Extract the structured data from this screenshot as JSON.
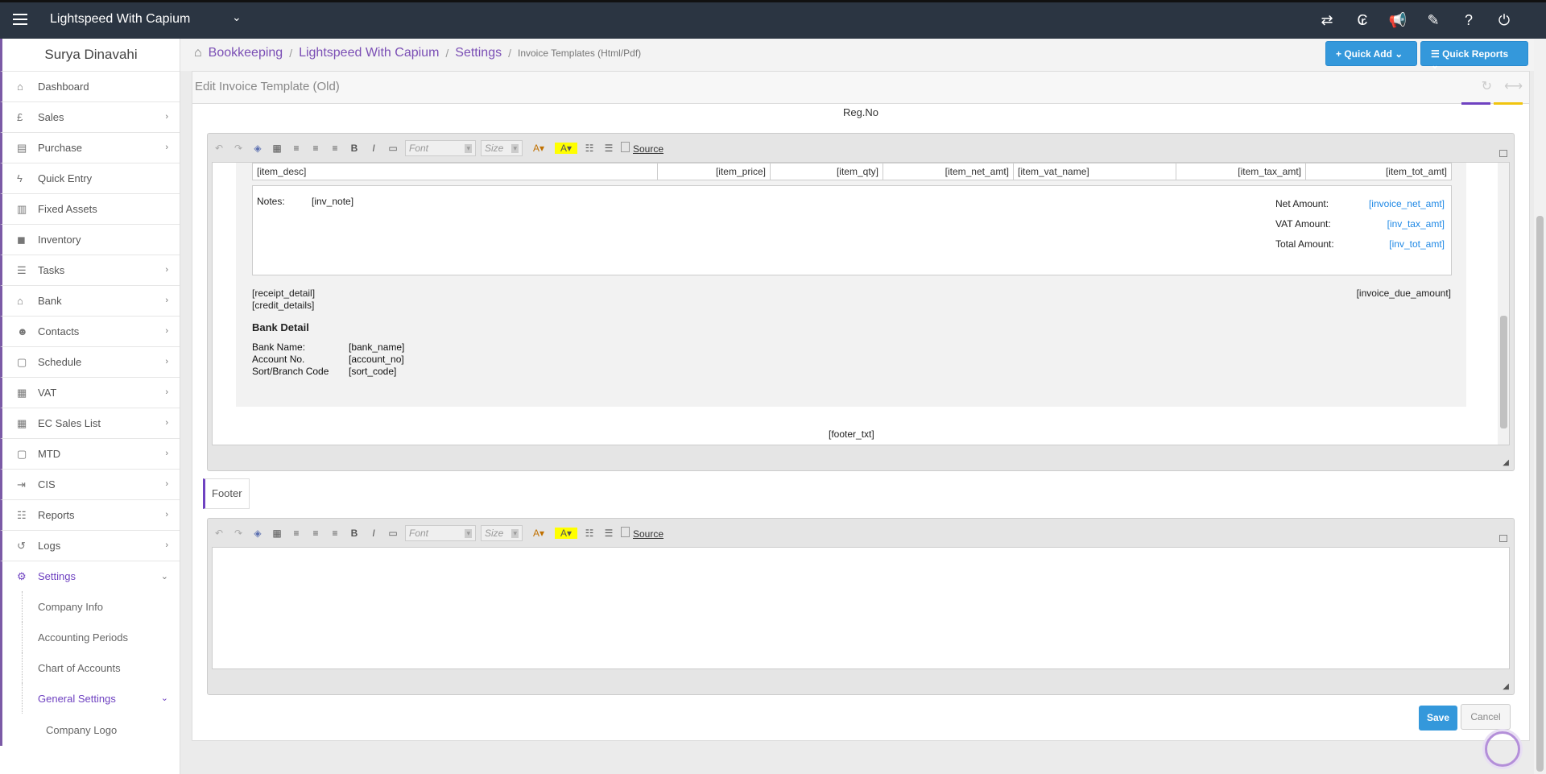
{
  "topbar": {
    "app_title": "Lightspeed With Capium",
    "icons": [
      "transfer-icon",
      "currency-icon",
      "megaphone-icon",
      "ticket-icon",
      "help-icon",
      "power-icon"
    ],
    "icon_glyphs": [
      "⇄",
      "₢",
      "📢",
      "✎",
      "?",
      "⏻"
    ]
  },
  "sidebar": {
    "user_name": "Surya Dinavahi",
    "items": [
      {
        "label": "Dashboard",
        "icon": "home-icon",
        "glyph": "⌂",
        "arrow": false
      },
      {
        "label": "Sales",
        "icon": "pound-icon",
        "glyph": "£",
        "arrow": true
      },
      {
        "label": "Purchase",
        "icon": "purchase-icon",
        "glyph": "▤",
        "arrow": true
      },
      {
        "label": "Quick Entry",
        "icon": "bolt-icon",
        "glyph": "ϟ",
        "arrow": false
      },
      {
        "label": "Fixed Assets",
        "icon": "building-icon",
        "glyph": "▥",
        "arrow": false
      },
      {
        "label": "Inventory",
        "icon": "truck-icon",
        "glyph": "◼",
        "arrow": false
      },
      {
        "label": "Tasks",
        "icon": "tasks-icon",
        "glyph": "☰",
        "arrow": true
      },
      {
        "label": "Bank",
        "icon": "bank-icon",
        "glyph": "⌂",
        "arrow": true
      },
      {
        "label": "Contacts",
        "icon": "users-icon",
        "glyph": "☻",
        "arrow": true
      },
      {
        "label": "Schedule",
        "icon": "calendar-icon",
        "glyph": "▢",
        "arrow": true
      },
      {
        "label": "VAT",
        "icon": "calculator-icon",
        "glyph": "▦",
        "arrow": true
      },
      {
        "label": "EC Sales List",
        "icon": "calculator-icon",
        "glyph": "▦",
        "arrow": true
      },
      {
        "label": "MTD",
        "icon": "calendar-icon",
        "glyph": "▢",
        "arrow": true
      },
      {
        "label": "CIS",
        "icon": "indent-icon",
        "glyph": "⇥",
        "arrow": true
      },
      {
        "label": "Reports",
        "icon": "list-icon",
        "glyph": "☷",
        "arrow": true
      },
      {
        "label": "Logs",
        "icon": "history-icon",
        "glyph": "↺",
        "arrow": true
      },
      {
        "label": "Settings",
        "icon": "cogs-icon",
        "glyph": "⚙",
        "arrow": true,
        "expanded": true
      }
    ],
    "settings_sub": [
      "Company Info",
      "Accounting Periods",
      "Chart of Accounts",
      "General Settings"
    ],
    "general_sub": [
      "Company Logo"
    ]
  },
  "breadcrumb": {
    "items": [
      "Bookkeeping",
      "Lightspeed With Capium",
      "Settings"
    ],
    "current": "Invoice Templates (Html/Pdf)"
  },
  "quick_add": "Quick Add",
  "quick_reports": "Quick Reports",
  "page": {
    "title": "Edit Invoice Template (Old)",
    "reg_no": "Reg.No"
  },
  "toolbar": {
    "font_placeholder": "Font",
    "size_placeholder": "Size",
    "source_label": "Source"
  },
  "template": {
    "item_cols": [
      "[item_desc]",
      "[item_price]",
      "[item_qty]",
      "[item_net_amt]",
      "[item_vat_name]",
      "[item_tax_amt]",
      "[item_tot_amt]"
    ],
    "notes_label": "Notes:",
    "notes_value": "[inv_note]",
    "net_label": "Net Amount:",
    "net_value": "[invoice_net_amt]",
    "vat_label": "VAT Amount:",
    "vat_value": "[inv_tax_amt]",
    "total_label": "Total Amount:",
    "total_value": "[inv_tot_amt]",
    "receipt_detail": "[receipt_detail]",
    "credit_details": "[credit_details]",
    "invoice_due": "[invoice_due_amount]",
    "bank_heading": "Bank Detail",
    "bank_name_label": "Bank Name:",
    "bank_name_value": "[bank_name]",
    "account_label": "Account No.",
    "account_value": "[account_no]",
    "sort_label": "Sort/Branch Code",
    "sort_value": "[sort_code]",
    "footer_txt": "[footer_txt]"
  },
  "footer_section_label": "Footer",
  "actions": {
    "save": "Save",
    "cancel": "Cancel"
  }
}
